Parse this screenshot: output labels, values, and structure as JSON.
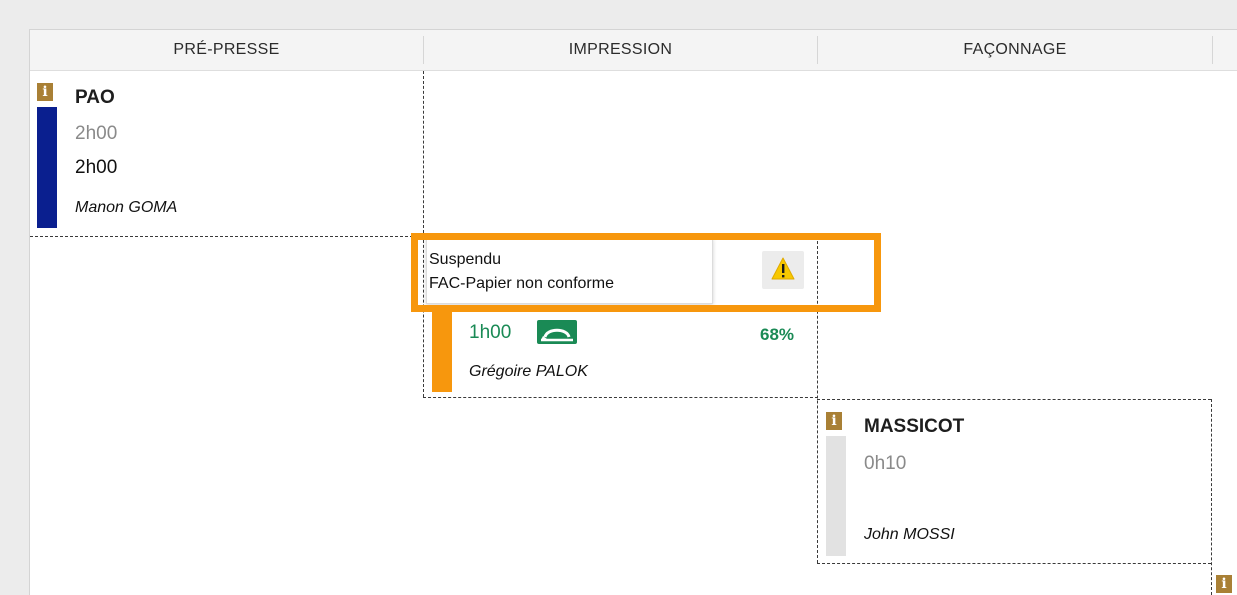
{
  "columns": [
    {
      "label": "PRÉ-PRESSE"
    },
    {
      "label": "IMPRESSION"
    },
    {
      "label": "FAÇONNAGE"
    }
  ],
  "tasks": {
    "pao": {
      "title": "PAO",
      "planned": "2h00",
      "actual": "2h00",
      "person": "Manon GOMA",
      "bar_color": "#0a1f8f"
    },
    "impression": {
      "time": "1h00",
      "progress_label": "68%",
      "progress_value": 0.68,
      "person": "Grégoire PALOK",
      "bar_color": "#f7970d"
    },
    "massicot": {
      "title": "MASSICOT",
      "planned": "0h10",
      "person": "John MOSSI",
      "bar_color": "#e2e2e2"
    }
  },
  "tooltip": {
    "status": "Suspendu",
    "reason": "FAC-Papier non conforme",
    "icon": "warning-icon"
  },
  "colors": {
    "highlight": "#f7970d",
    "info_icon": "#a98035",
    "progress_green": "#1a8a55",
    "warning": "#f7c800"
  }
}
